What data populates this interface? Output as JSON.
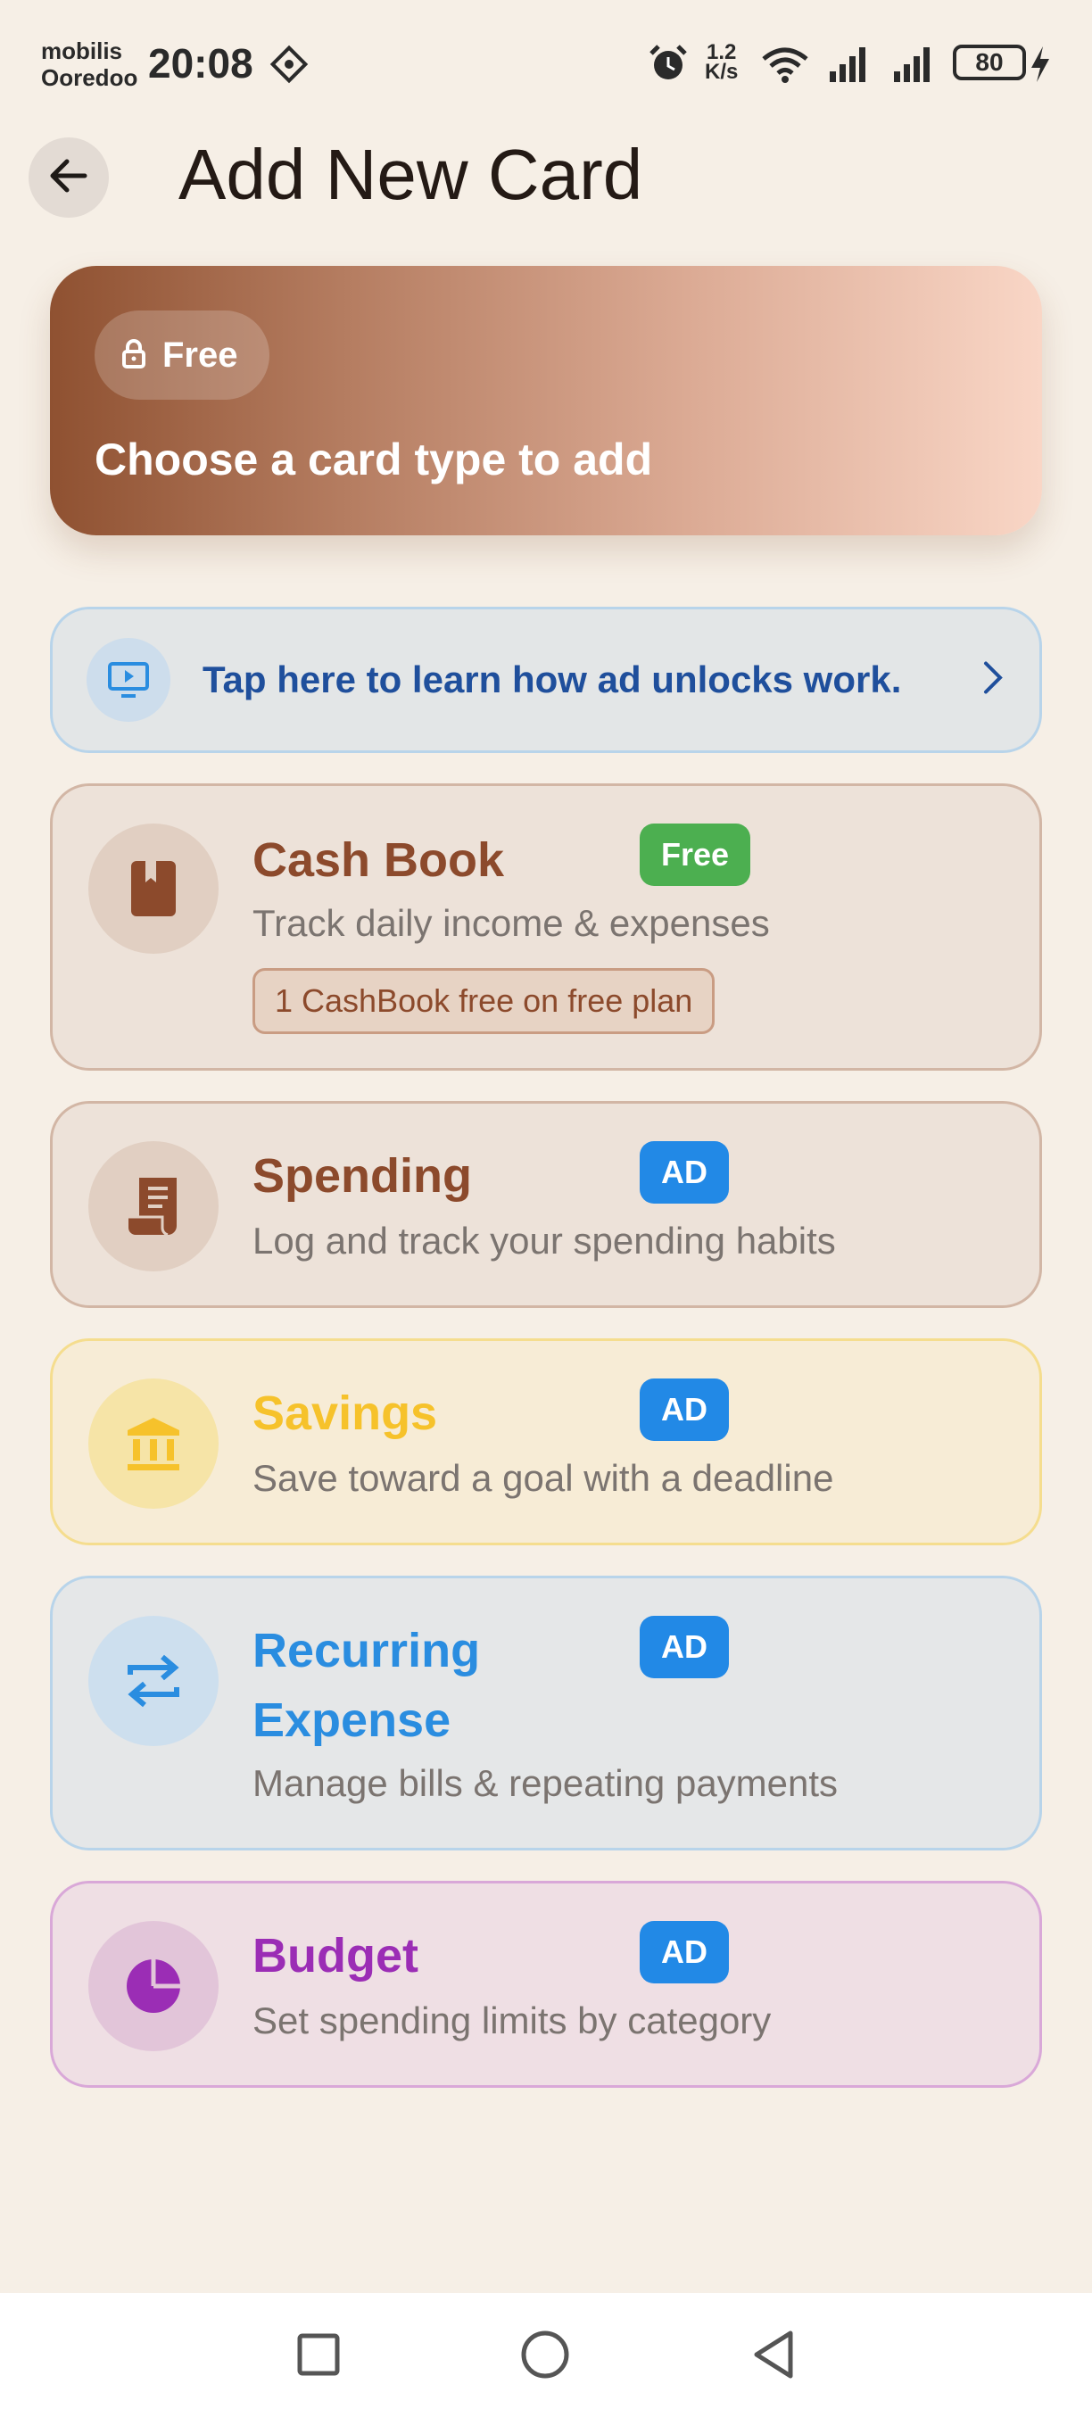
{
  "status_bar": {
    "carrier_line1": "mobilis",
    "carrier_line2": "Ooredoo",
    "time": "20:08",
    "network_speed_value": "1.2",
    "network_speed_unit": "K/s",
    "battery": "80",
    "icons": [
      "location-diamond-icon",
      "alarm-icon",
      "wifi-icon",
      "signal-icon",
      "signal-icon",
      "battery-icon",
      "charging-icon"
    ]
  },
  "header": {
    "back_icon": "arrow-left-icon",
    "title": "Add New Card"
  },
  "hero": {
    "badge_icon": "lock-icon",
    "badge_label": "Free",
    "title": "Choose a card type to add"
  },
  "info_banner": {
    "icon": "video-icon",
    "text": "Tap here to learn how ad unlocks work.",
    "chevron_icon": "chevron-right-icon"
  },
  "cards": [
    {
      "icon": "book-icon",
      "title": "Cash Book",
      "badge": "Free",
      "description": "Track daily income & expenses",
      "note": "1 CashBook free on free plan",
      "accent": "#8c4a2c"
    },
    {
      "icon": "receipt-icon",
      "title": "Spending",
      "badge": "AD",
      "description": "Log and track your spending habits",
      "accent": "#8c4a2c"
    },
    {
      "icon": "bank-icon",
      "title": "Savings",
      "badge": "AD",
      "description": "Save toward a goal with a deadline",
      "accent": "#f6c22b"
    },
    {
      "icon": "repeat-icon",
      "title_line1": "Recurring",
      "title_line2": "Expense",
      "badge": "AD",
      "description": "Manage bills & repeating payments",
      "accent": "#2a8de0"
    },
    {
      "icon": "pie-chart-icon",
      "title": "Budget",
      "badge": "AD",
      "description": "Set spending limits by category",
      "accent": "#9b2db5"
    }
  ],
  "colors": {
    "background": "#f6efe6",
    "free_badge": "#4caf50",
    "ad_badge": "#2289e6",
    "info_text": "#1f4f9c"
  },
  "nav_bar": {
    "icons": [
      "recents-square-icon",
      "home-circle-icon",
      "back-triangle-icon"
    ]
  }
}
